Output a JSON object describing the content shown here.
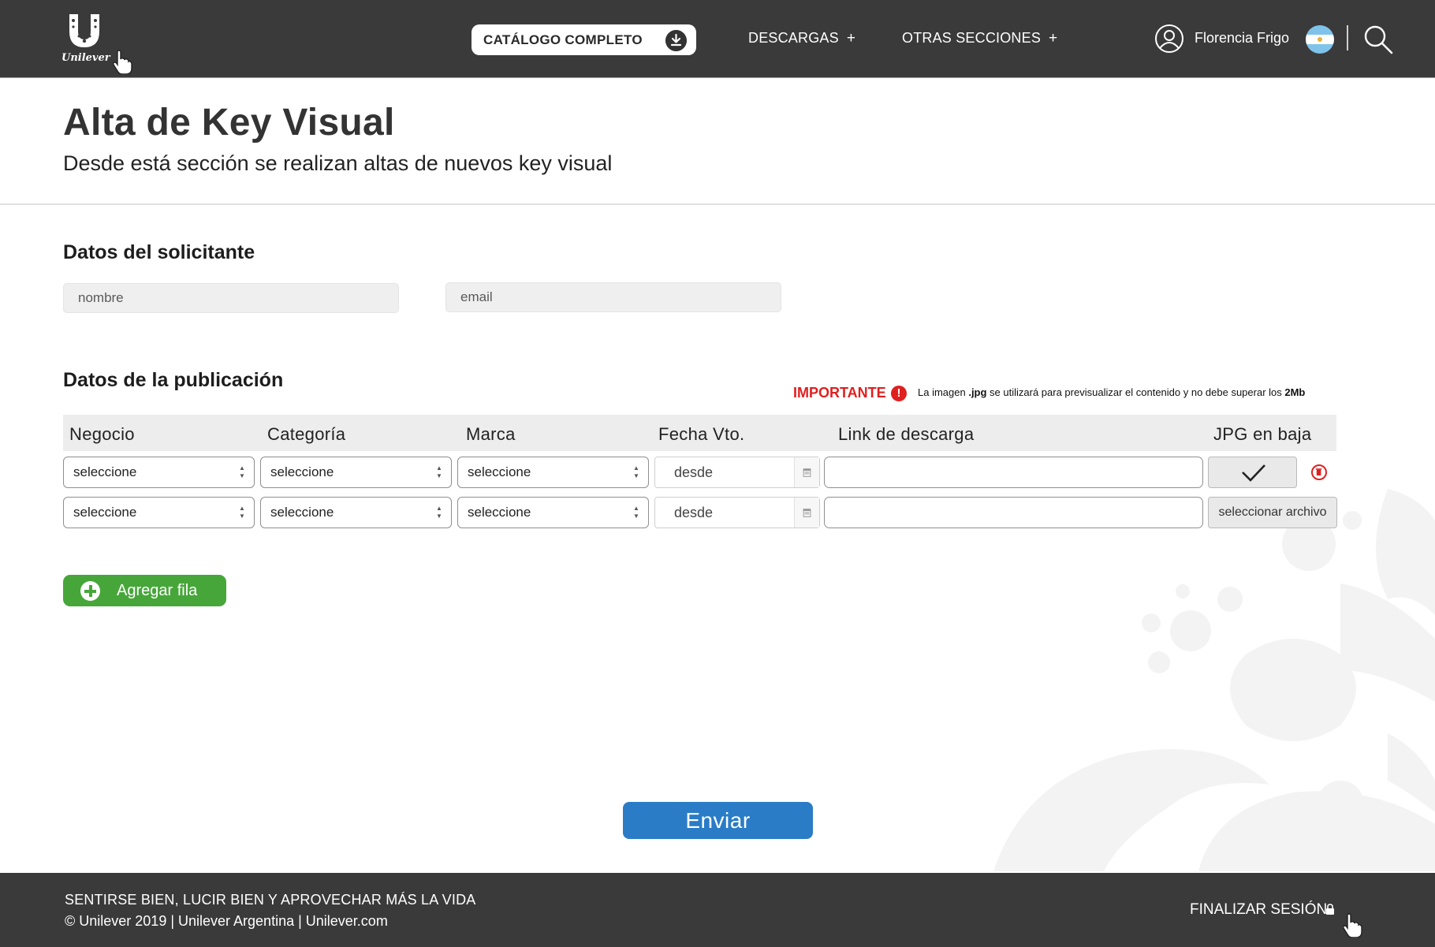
{
  "header": {
    "brand": "Unilever",
    "catalog_button": "CATÁLOGO COMPLETO",
    "nav": [
      {
        "label": "DESCARGAS",
        "suffix": "+"
      },
      {
        "label": "OTRAS SECCIONES",
        "suffix": "+"
      }
    ],
    "user_name": "Florencia Frigo"
  },
  "page": {
    "title": "Alta de Key Visual",
    "subtitle": "Desde está sección se realizan altas de nuevos key visual"
  },
  "solicitante": {
    "title": "Datos del solicitante",
    "name_placeholder": "nombre",
    "email_placeholder": "email"
  },
  "publicacion": {
    "title": "Datos de la publicación",
    "important_label": "IMPORTANTE",
    "important_note_prefix": "La imagen ",
    "important_note_ext": ".jpg",
    "important_note_mid": " se utilizará para previsualizar el contenido y no debe superar los ",
    "important_note_size": "2Mb",
    "columns": [
      "Negocio",
      "Categoría",
      "Marca",
      "Fecha Vto.",
      "Link de descarga",
      "JPG en baja"
    ],
    "rows": [
      {
        "negocio": "seleccione",
        "categoria": "seleccione",
        "marca": "seleccione",
        "fecha": "desde",
        "link": "",
        "jpg_state": "uploaded"
      },
      {
        "negocio": "seleccione",
        "categoria": "seleccione",
        "marca": "seleccione",
        "fecha": "desde",
        "link": "",
        "jpg_state": "empty"
      }
    ],
    "file_button": "seleccionar archivo",
    "add_row": "Agregar fila",
    "submit": "Enviar"
  },
  "footer": {
    "tagline": "SENTIRSE BIEN, LUCIR BIEN Y APROVECHAR MÁS LA VIDA",
    "copyright": "© Unilever 2019 | Unilever Argentina | Unilever.com",
    "logout": "FINALIZAR SESIÓN"
  },
  "colors": {
    "header_bg": "#3a3a3a",
    "primary_blue": "#2a7cc7",
    "add_green": "#47a63a",
    "important_red": "#e01f1f"
  },
  "icons": [
    "unilever-logo",
    "download-icon",
    "user-icon",
    "argentina-flag-icon",
    "search-icon",
    "alert-icon",
    "check-icon",
    "trash-icon",
    "calendar-icon",
    "plus-circle-icon",
    "lock-icon",
    "hand-cursor-icon"
  ]
}
